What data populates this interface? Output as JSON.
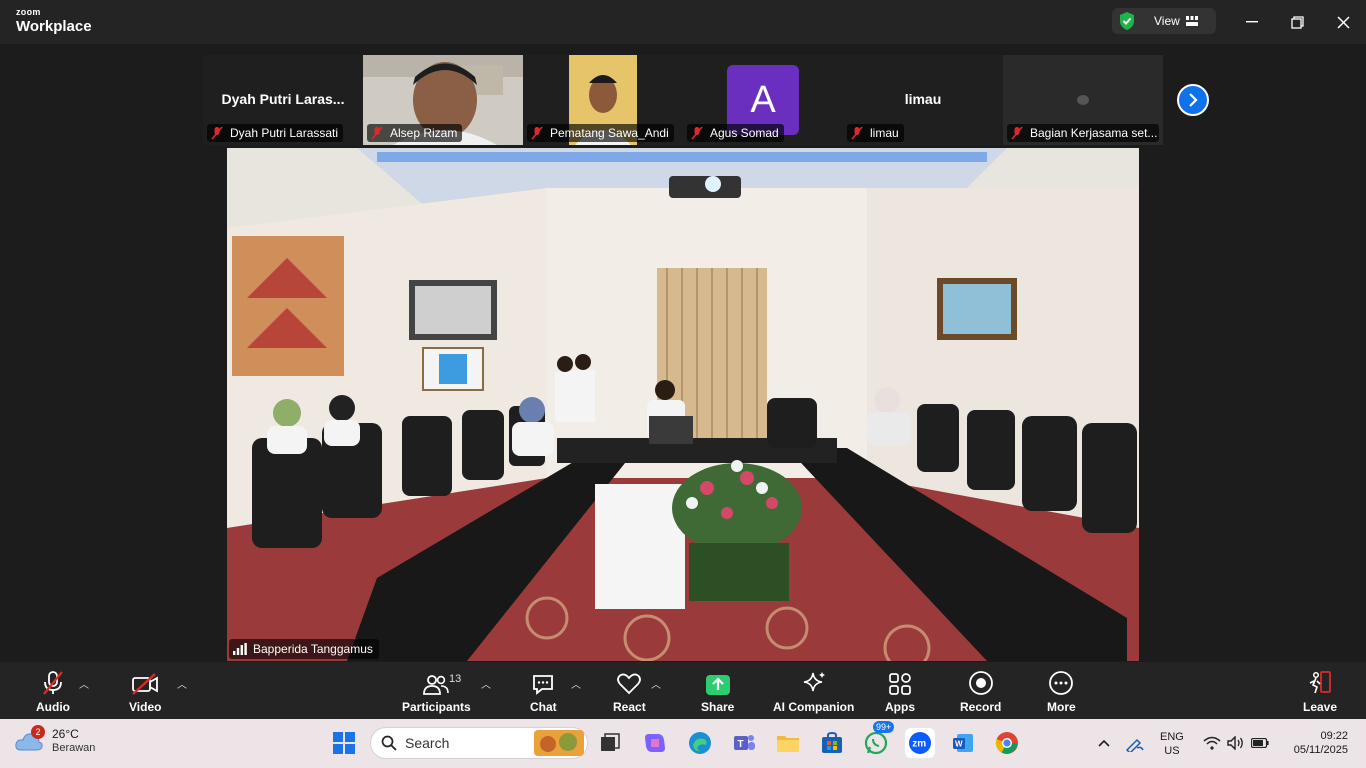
{
  "app": {
    "brand_small": "zoom",
    "brand_big": "Workplace",
    "view_label": "View"
  },
  "thumbnails": [
    {
      "big_name": "Dyah Putri Laras...",
      "label": "Dyah Putri Larassati"
    },
    {
      "big_name": "",
      "label": "Alsep Rizam"
    },
    {
      "big_name": "",
      "label": "Pematang Sawa_Andi"
    },
    {
      "avatar_letter": "A",
      "label": "Agus Somad"
    },
    {
      "big_name": "limau",
      "label": "limau"
    },
    {
      "big_name": "",
      "label": "Bagian Kerjasama set..."
    }
  ],
  "main_video": {
    "label": "Bapperida Tanggamus"
  },
  "toolbar": {
    "audio": "Audio",
    "video": "Video",
    "participants": "Participants",
    "participants_count": "13",
    "chat": "Chat",
    "react": "React",
    "share": "Share",
    "ai_companion": "AI Companion",
    "apps": "Apps",
    "record": "Record",
    "more": "More",
    "leave": "Leave"
  },
  "taskbar": {
    "weather_badge": "2",
    "weather_temp": "26°C",
    "weather_desc": "Berawan",
    "search_label": "Search",
    "whatsapp_badge": "99+",
    "lang_1": "ENG",
    "lang_2": "US",
    "time": "09:22",
    "date": "05/11/2025"
  },
  "colors": {
    "accent": "#0e72ed",
    "share_green": "#2ecc71",
    "leave_red": "#e02828",
    "avatar_purple": "#6b2fbf",
    "shield_green": "#1fb34a"
  }
}
